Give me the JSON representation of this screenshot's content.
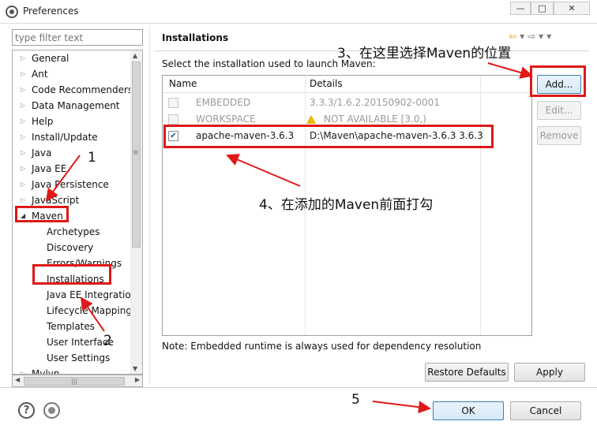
{
  "window": {
    "title": "Preferences",
    "controls": {
      "minimize": "—",
      "maximize": "□",
      "close": "✕"
    }
  },
  "filter": {
    "placeholder": "type filter text"
  },
  "tree": {
    "items": [
      {
        "label": "General",
        "arrow": "▷"
      },
      {
        "label": "Ant",
        "arrow": "▷"
      },
      {
        "label": "Code Recommenders",
        "arrow": "▷"
      },
      {
        "label": "Data Management",
        "arrow": "▷"
      },
      {
        "label": "Help",
        "arrow": "▷"
      },
      {
        "label": "Install/Update",
        "arrow": "▷"
      },
      {
        "label": "Java",
        "arrow": "▷"
      },
      {
        "label": "Java EE",
        "arrow": "▷"
      },
      {
        "label": "Java Persistence",
        "arrow": "▷"
      },
      {
        "label": "JavaScript",
        "arrow": "▷"
      },
      {
        "label": "Maven",
        "arrow": "◢"
      },
      {
        "label": "Archetypes"
      },
      {
        "label": "Discovery"
      },
      {
        "label": "Errors/Warnings"
      },
      {
        "label": "Installations"
      },
      {
        "label": "Java EE Integration"
      },
      {
        "label": "Lifecycle Mapping"
      },
      {
        "label": "Templates"
      },
      {
        "label": "User Interface"
      },
      {
        "label": "User Settings"
      },
      {
        "label": "Mylyn",
        "arrow": "▷"
      }
    ]
  },
  "page": {
    "title": "Installations",
    "description": "Select the installation used to launch Maven:",
    "table": {
      "headers": [
        "Name",
        "Details"
      ],
      "rows": [
        {
          "checked": false,
          "enabled": false,
          "name": "EMBEDDED",
          "details": "3.3.3/1.6.2.20150902-0001"
        },
        {
          "checked": false,
          "enabled": false,
          "name": "WORKSPACE",
          "details": "NOT AVAILABLE [3.0,)",
          "icon": "warning-icon"
        },
        {
          "checked": true,
          "enabled": true,
          "name": "apache-maven-3.6.3",
          "details": "D:\\Maven\\apache-maven-3.6.3 3.6.3"
        }
      ]
    },
    "buttons": {
      "add": "Add...",
      "edit": "Edit...",
      "remove": "Remove"
    },
    "note": "Note: Embedded runtime is always used for dependency resolution",
    "restore_defaults": "Restore Defaults",
    "apply": "Apply"
  },
  "dialog": {
    "ok": "OK",
    "cancel": "Cancel"
  },
  "annotations": {
    "step1": "1",
    "step2": "2",
    "step3": "3、在这里选择Maven的位置",
    "step4": "4、在添加的Maven前面打勾",
    "step5": "5"
  },
  "colors": {
    "highlight": "#e01818",
    "accent": "#3c7fb1"
  }
}
